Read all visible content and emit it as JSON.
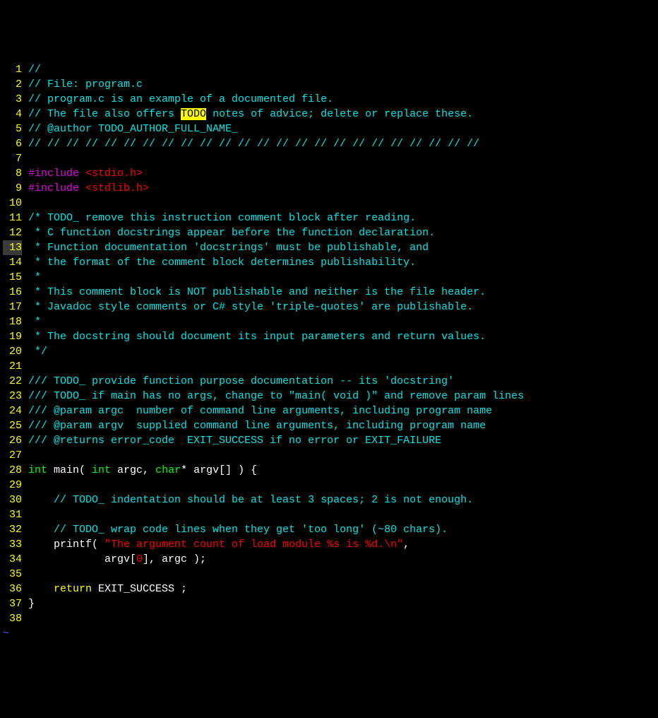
{
  "lines": {
    "l1": "//",
    "l2": "// File: program.c",
    "l3": "// program.c is an example of a documented file.",
    "l4a": "// The file also offers ",
    "l4_todo": "TODO",
    "l4b": " notes of advice; delete or replace these.",
    "l5": "// @author TODO_AUTHOR_FULL_NAME_",
    "l6": "// // // // // // // // // // // // // // // // // // // // // // // //",
    "l8a": "#include",
    "l8b": " <stdio.h>",
    "l9a": "#include",
    "l9b": " <stdlib.h>",
    "l11": "/* TODO_ remove this instruction comment block after reading.",
    "l12": " * C function docstrings appear before the function declaration.",
    "l13": " * Function documentation 'docstrings' must be publishable, and",
    "l14": " * the format of the comment block determines publishability.",
    "l15": " *",
    "l16": " * This comment block is NOT publishable and neither is the file header.",
    "l17": " * Javadoc style comments or C# style 'triple-quotes' are publishable.",
    "l18": " *",
    "l19": " * The docstring should document its input parameters and return values.",
    "l20": " */",
    "l22": "/// TODO_ provide function purpose documentation -- its 'docstring'",
    "l23": "/// TODO_ if main has no args, change to \"main( void )\" and remove param lines",
    "l24": "/// @param argc  number of command line arguments, including program name",
    "l25": "/// @param argv  supplied command line arguments, including program name",
    "l26": "/// @returns error_code  EXIT_SUCCESS if no error or EXIT_FAILURE",
    "l28_int": "int",
    "l28_main": " main( ",
    "l28_int2": "int",
    "l28_argc": " argc, ",
    "l28_char": "char",
    "l28_rest": "* argv[] ) {",
    "l30": "    // TODO_ indentation should be at least 3 spaces; 2 is not enough.",
    "l32": "    // TODO_ wrap code lines when they get 'too long' (~80 chars).",
    "l33_indent": "    printf( ",
    "l33_str": "\"The argument count of load module %s is %d.\\n\"",
    "l33_end": ",",
    "l34_indent": "            argv[",
    "l34_zero": "0",
    "l34_end": "], argc );",
    "l36_indent": "    ",
    "l36_return": "return",
    "l36_rest": " EXIT_SUCCESS ;",
    "l37": "}",
    "tilde": "~",
    "n1": "1",
    "n2": "2",
    "n3": "3",
    "n4": "4",
    "n5": "5",
    "n6": "6",
    "n7": "7",
    "n8": "8",
    "n9": "9",
    "n10": "10",
    "n11": "11",
    "n12": "12",
    "n13": "13",
    "n14": "14",
    "n15": "15",
    "n16": "16",
    "n17": "17",
    "n18": "18",
    "n19": "19",
    "n20": "20",
    "n21": "21",
    "n22": "22",
    "n23": "23",
    "n24": "24",
    "n25": "25",
    "n26": "26",
    "n27": "27",
    "n28": "28",
    "n29": "29",
    "n30": "30",
    "n31": "31",
    "n32": "32",
    "n33": "33",
    "n34": "34",
    "n35": "35",
    "n36": "36",
    "n37": "37",
    "n38": "38"
  }
}
